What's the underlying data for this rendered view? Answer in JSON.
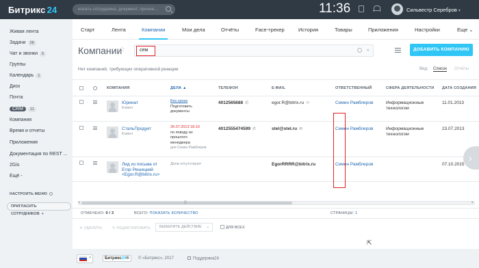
{
  "top": {
    "logo_name": "Битрикс",
    "logo_num": "24",
    "search_placeholder": "искать сотрудника, документ, прочее...",
    "time": "11:36",
    "user_name": "Сильвестр Серебров"
  },
  "sidebar": {
    "items": [
      {
        "label": "Живая лента"
      },
      {
        "label": "Задачи",
        "count": "28"
      },
      {
        "label": "Чат и звонки",
        "count": "5"
      },
      {
        "label": "Группы"
      },
      {
        "label": "Календарь",
        "count": "1"
      },
      {
        "label": "Диск"
      },
      {
        "label": "Почта"
      },
      {
        "label": "CRM",
        "count": "11"
      },
      {
        "label": "Компания"
      },
      {
        "label": "Время и отчеты"
      },
      {
        "label": "Приложения"
      },
      {
        "label": "Документация по REST ..."
      },
      {
        "label": "2Gis"
      },
      {
        "label": "Ещё -"
      }
    ],
    "settings_label": "НАСТРОИТЬ МЕНЮ",
    "invite_label": "ПРИГЛАСИТЬ СОТРУДНИКОВ",
    "invite_plus": "+"
  },
  "tabs": [
    "Старт",
    "Лента",
    "Компании",
    "Мои дела",
    "Отчёты",
    "Face-трекер",
    "История",
    "Товары",
    "Приложения",
    "Настройки",
    "Еще"
  ],
  "tabs_more_caret": "⌄",
  "active_tab": "Компании",
  "page": {
    "title": "Компании",
    "star": "☆",
    "filter_value": "сем",
    "filter_clear": "×",
    "add_button": "ДОБАВИТЬ КОМПАНИЮ",
    "no_reaction": "Нет компаний, требующих оперативной реакции",
    "view_label": "Вид:",
    "view_list": "Список",
    "view_reports": "Отчёты"
  },
  "grid": {
    "headers": [
      "КОМПАНИЯ",
      "ДЕЛА ▲",
      "ТЕЛЕФОН",
      "E-MAIL",
      "ОТВЕТСТВЕННЫЙ",
      "СФЕРА ДЕЯТЕЛЬНОСТИ",
      "ДАТА СОЗДАНИЯ"
    ],
    "rows": [
      {
        "name": "Юринат",
        "type": "Клиент",
        "deal_status": "Без срока",
        "deal_text": [
          "Подготовить",
          "документы"
        ],
        "phone": "4012565688",
        "email": "egor.R@bitrix.ru",
        "responsible": "Семен Рамблеров",
        "sphere": [
          "Информационные",
          "технологии"
        ],
        "date": "11.01.2013"
      },
      {
        "name": "СтальПродукт",
        "type": "Клиент",
        "deal_overdue": "26.07.2013 18:10",
        "deal_text": [
          "по поводу их",
          "прошлого",
          "менеджера"
        ],
        "deal_for": "для Семен Рамблеров",
        "phone": "4012555474599",
        "email": "stel@stel.ru",
        "responsible": "Семен Рамблеров",
        "sphere": [
          "Информационные",
          "технологии"
        ],
        "date": "23.07.2013"
      },
      {
        "name_lines": [
          "Лид из письма от",
          "Егор Решецкий",
          "<Egor.R@bitrix.ru>"
        ],
        "deal_none": "Дела отсутствуют",
        "email": "EgorRRRR@bitrix.ru",
        "responsible": "Семен Рамблеров",
        "date": "07.10.2015"
      }
    ]
  },
  "scrollbar": {
    "left": "◂",
    "grip": "|||",
    "right": "▸"
  },
  "stats": {
    "marked_label": "ОТМЕЧЕНО:",
    "marked_value": "0 / 3",
    "total_label": "ВСЕГО:",
    "total_link": "ПОКАЗАТЬ КОЛИЧЕСТВО",
    "pages_label": "СТРАНИЦЫ:",
    "pages_value": "1"
  },
  "actions": {
    "delete_icon": "✕",
    "delete": "УДАЛИТЬ",
    "edit_icon": "✎",
    "edit": "РЕДАКТИРОВАТЬ",
    "select_action": "ВЫБЕРИТЕ ДЕЙСТВИЕ",
    "for_all": "ДЛЯ ВСЕХ"
  },
  "footer": {
    "brand_name": "Битрикс",
    "brand_num": "24",
    "brand_suffix": "®",
    "copyright": "© «Битрикс», 2017",
    "support": "Поддержка24"
  },
  "colors": {
    "accent": "#2fc6f6",
    "topbar": "#2f3a45",
    "link": "#2067b0",
    "highlight": "#e02020"
  }
}
